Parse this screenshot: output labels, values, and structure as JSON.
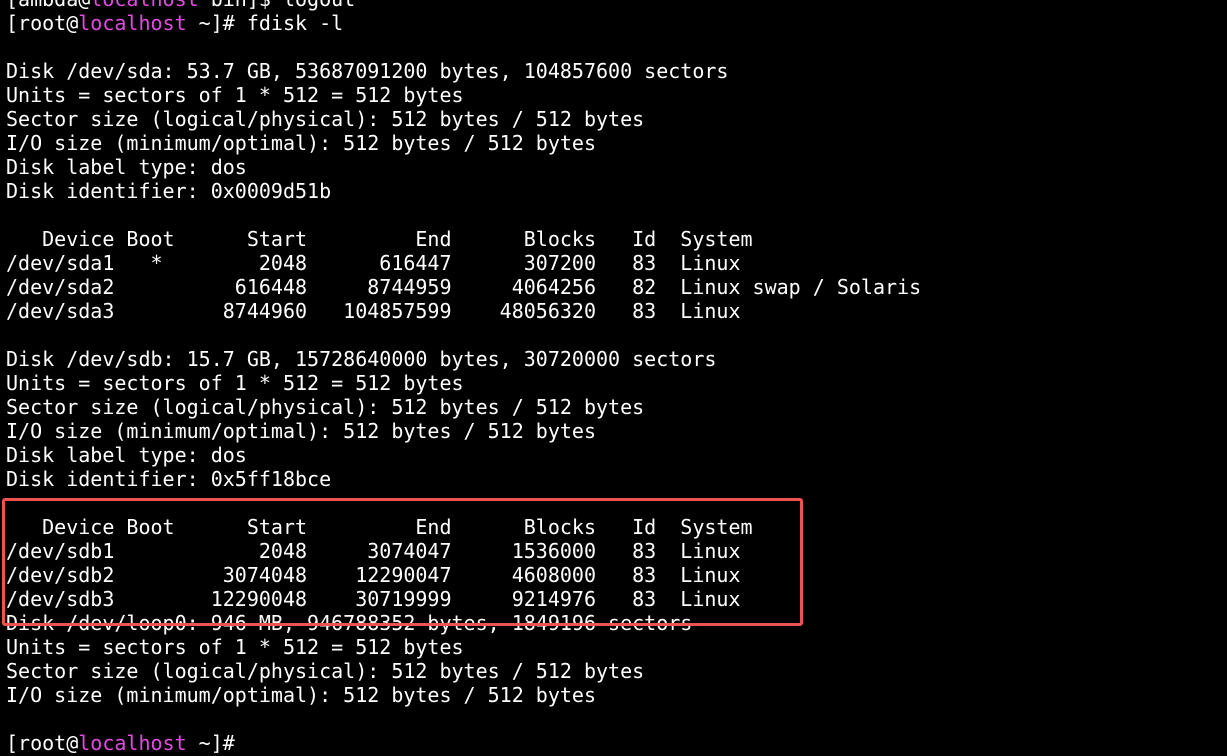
{
  "terminal": {
    "prev_prompt": {
      "user_open": "[ambda@",
      "host": "localhost",
      "rest": " bin]$ logout"
    },
    "prompt": {
      "user_open": "[root@",
      "host": "localhost",
      "rest": " ~]# ",
      "command": "fdisk -l"
    },
    "sda": {
      "lines": [
        "Disk /dev/sda: 53.7 GB, 53687091200 bytes, 104857600 sectors",
        "Units = sectors of 1 * 512 = 512 bytes",
        "Sector size (logical/physical): 512 bytes / 512 bytes",
        "I/O size (minimum/optimal): 512 bytes / 512 bytes",
        "Disk label type: dos",
        "Disk identifier: 0x0009d51b"
      ],
      "table_header": "   Device Boot      Start         End      Blocks   Id  System",
      "rows": [
        "/dev/sda1   *        2048      616447      307200   83  Linux",
        "/dev/sda2          616448     8744959     4064256   82  Linux swap / Solaris",
        "/dev/sda3         8744960   104857599    48056320   83  Linux"
      ]
    },
    "sdb": {
      "lines": [
        "Disk /dev/sdb: 15.7 GB, 15728640000 bytes, 30720000 sectors",
        "Units = sectors of 1 * 512 = 512 bytes",
        "Sector size (logical/physical): 512 bytes / 512 bytes",
        "I/O size (minimum/optimal): 512 bytes / 512 bytes",
        "Disk label type: dos",
        "Disk identifier: 0x5ff18bce"
      ],
      "table_header": "   Device Boot      Start         End      Blocks   Id  System",
      "rows": [
        "/dev/sdb1            2048     3074047     1536000   83  Linux",
        "/dev/sdb2         3074048    12290047     4608000   83  Linux",
        "/dev/sdb3        12290048    30719999     9214976   83  Linux"
      ]
    },
    "loop0": {
      "lines": [
        "Disk /dev/loop0: 946 MB, 946788352 bytes, 1849196 sectors",
        "Units = sectors of 1 * 512 = 512 bytes",
        "Sector size (logical/physical): 512 bytes / 512 bytes",
        "I/O size (minimum/optimal): 512 bytes / 512 bytes"
      ]
    },
    "next_prompt": {
      "user_open": "[root@",
      "host": "localhost",
      "rest": " ~]# "
    },
    "colors": {
      "background": "#000000",
      "text": "#ffffff",
      "hostname": "#e24be0",
      "highlight_border": "#ef5350"
    }
  }
}
